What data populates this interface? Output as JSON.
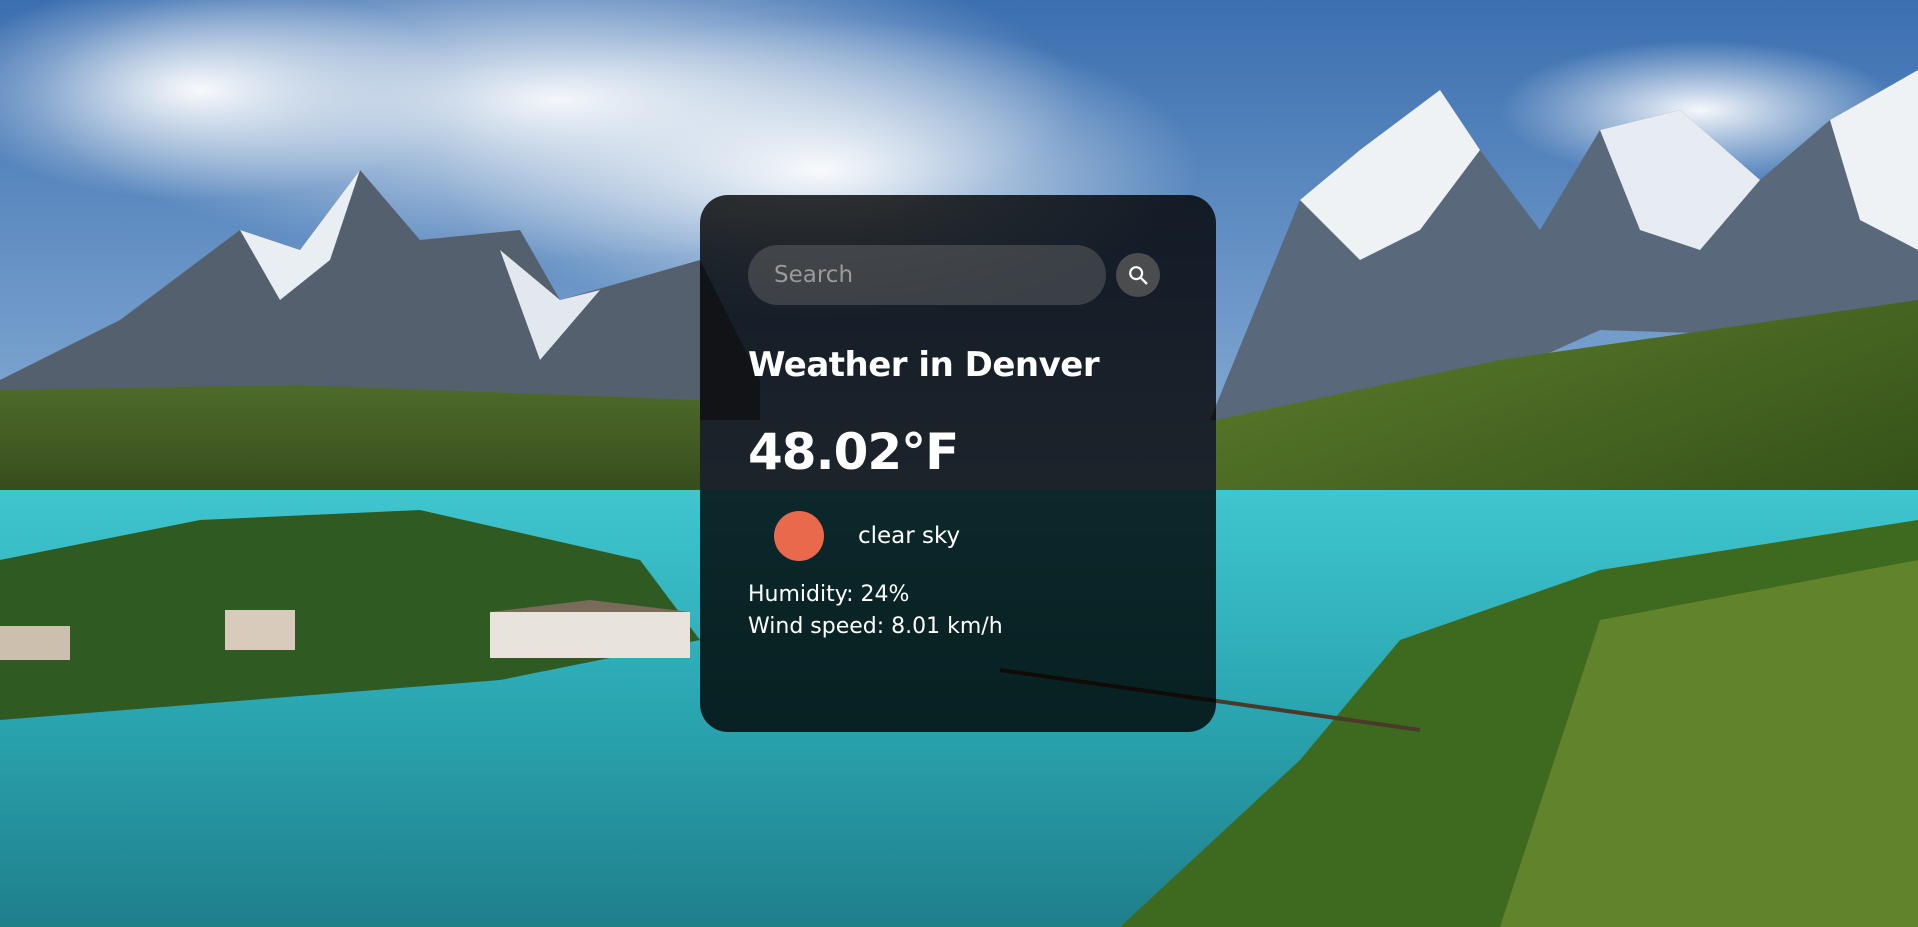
{
  "search": {
    "placeholder": "Search",
    "button_icon": "search-icon"
  },
  "weather": {
    "title": "Weather in Denver",
    "temperature": "48.02°F",
    "condition_icon": "sun-icon",
    "condition_color": "#e8694b",
    "description": "clear sky",
    "humidity": "Humidity: 24%",
    "wind": "Wind speed: 8.01 km/h"
  },
  "colors": {
    "card_background": "rgba(0,0,0,0.80)",
    "text": "#ffffff"
  }
}
